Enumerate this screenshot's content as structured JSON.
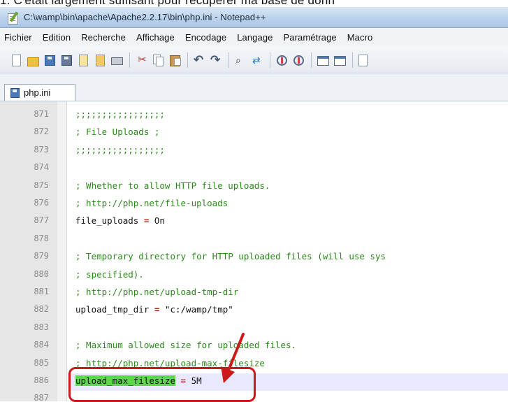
{
  "page_text": "1. C'était largement suffisant pour récupérer ma base de donn",
  "window": {
    "title": "C:\\wamp\\bin\\apache\\Apache2.2.17\\bin\\php.ini - Notepad++"
  },
  "menu": [
    "Fichier",
    "Edition",
    "Recherche",
    "Affichage",
    "Encodage",
    "Langage",
    "Paramétrage",
    "Macro"
  ],
  "toolbar": {
    "icons": [
      "new-file-icon",
      "open-folder-icon",
      "save-icon",
      "save-all-icon",
      "close-icon",
      "close-all-icon",
      "print-icon",
      "cut-icon",
      "copy-icon",
      "paste-icon",
      "undo-icon",
      "redo-icon",
      "find-icon",
      "replace-icon",
      "zoom-in-icon",
      "zoom-out-icon",
      "sync-vertical-icon",
      "sync-horizontal-icon",
      "wrap-icon"
    ]
  },
  "tab": {
    "label": "php.ini"
  },
  "editor": {
    "lines": [
      {
        "n": "871",
        "parts": [
          {
            "t": ";;;;;;;;;;;;;;;;;",
            "k": "comment"
          }
        ]
      },
      {
        "n": "872",
        "parts": [
          {
            "t": "; File Uploads ;",
            "k": "comment"
          }
        ]
      },
      {
        "n": "873",
        "parts": [
          {
            "t": ";;;;;;;;;;;;;;;;;",
            "k": "comment"
          }
        ]
      },
      {
        "n": "874",
        "parts": []
      },
      {
        "n": "875",
        "parts": [
          {
            "t": "; Whether to allow HTTP file uploads.",
            "k": "comment"
          }
        ]
      },
      {
        "n": "876",
        "parts": [
          {
            "t": "; http://php.net/file-uploads",
            "k": "comment"
          }
        ]
      },
      {
        "n": "877",
        "parts": [
          {
            "t": "file_uploads ",
            "k": "text"
          },
          {
            "t": "=",
            "k": "op"
          },
          {
            "t": " On",
            "k": "text"
          }
        ]
      },
      {
        "n": "878",
        "parts": []
      },
      {
        "n": "879",
        "parts": [
          {
            "t": "; Temporary directory for HTTP uploaded files (will use sys",
            "k": "comment"
          }
        ]
      },
      {
        "n": "880",
        "parts": [
          {
            "t": "; specified).",
            "k": "comment"
          }
        ]
      },
      {
        "n": "881",
        "parts": [
          {
            "t": "; http://php.net/upload-tmp-dir",
            "k": "comment"
          }
        ]
      },
      {
        "n": "882",
        "parts": [
          {
            "t": "upload_tmp_dir ",
            "k": "text"
          },
          {
            "t": "=",
            "k": "op"
          },
          {
            "t": " \"c:/wamp/tmp\"",
            "k": "text"
          }
        ]
      },
      {
        "n": "883",
        "parts": []
      },
      {
        "n": "884",
        "parts": [
          {
            "t": "; Maximum allowed size for uploaded files.",
            "k": "comment"
          }
        ]
      },
      {
        "n": "885",
        "parts": [
          {
            "t": "; http://php.net/upload-max-filesize",
            "k": "comment"
          }
        ]
      },
      {
        "n": "886",
        "parts": [
          {
            "t": "upload_max_filesize",
            "k": "hl"
          },
          {
            "t": " ",
            "k": "text"
          },
          {
            "t": "=",
            "k": "op"
          },
          {
            "t": " 5M",
            "k": "text"
          }
        ],
        "current": true
      },
      {
        "n": "887",
        "parts": []
      }
    ]
  },
  "colors": {
    "comment": "#2a8a1a",
    "operator": "#d02020",
    "highlight": "#5cd64a",
    "annotation": "#cc1a1a"
  }
}
